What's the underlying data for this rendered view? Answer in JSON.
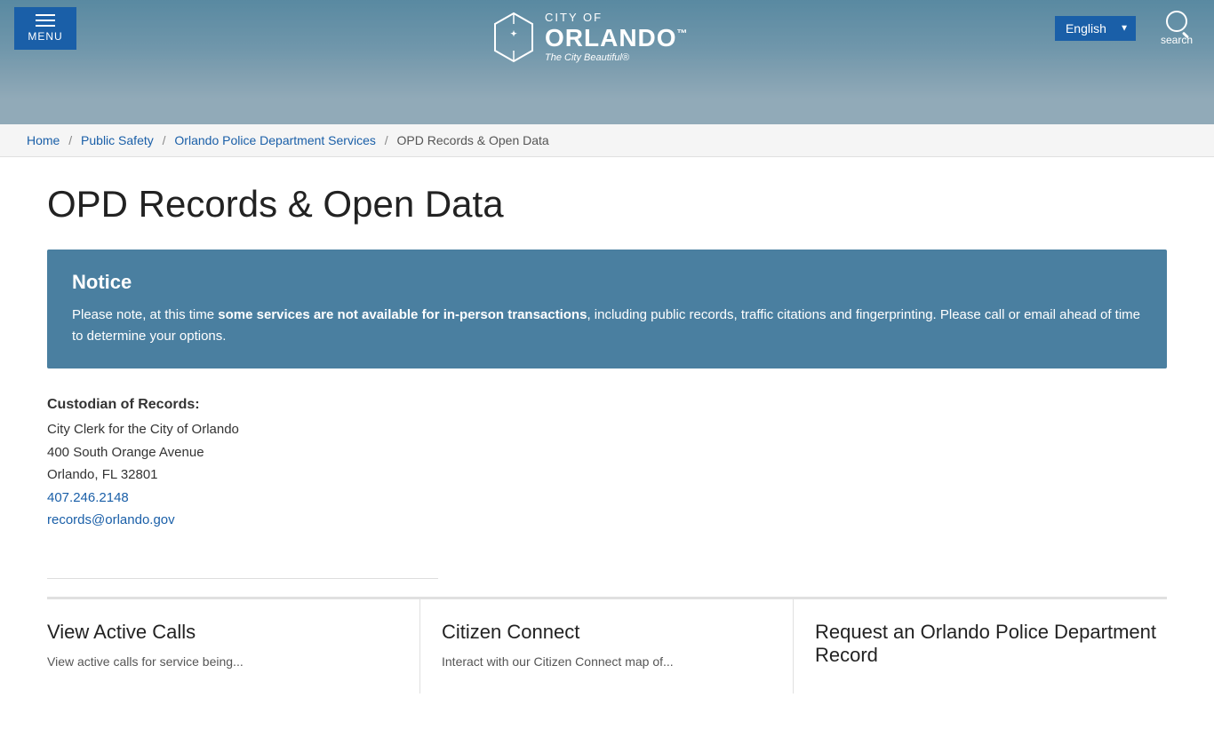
{
  "header": {
    "menu_label": "menu",
    "logo_city_of": "CITY OF",
    "logo_orlando": "ORLANDO",
    "logo_trademark": "™",
    "logo_tagline": "The City Beautiful®",
    "language_label": "English",
    "search_label": "search"
  },
  "breadcrumb": {
    "home": "Home",
    "public_safety": "Public Safety",
    "opd_services": "Orlando Police Department Services",
    "current": "OPD Records & Open Data"
  },
  "page": {
    "title": "OPD Records & Open Data"
  },
  "notice": {
    "title": "Notice",
    "text_before_bold": "Please note, at this time ",
    "bold_text": "some services are not available for in-person transactions",
    "text_after_bold": ", including public records, traffic citations and fingerprinting. Please call or email ahead of time to determine your options."
  },
  "custodian": {
    "section_title": "Custodian of Records:",
    "name": "City Clerk for the City of Orlando",
    "address1": "400 South Orange Avenue",
    "address2": "Orlando, FL 32801",
    "phone": "407.246.2148",
    "email": "records@orlando.gov"
  },
  "cards": [
    {
      "title": "View Active Calls",
      "desc": "View active calls for service being..."
    },
    {
      "title": "Citizen Connect",
      "desc": "Interact with our Citizen Connect map of..."
    },
    {
      "title": "Request an Orlando Police Department Record",
      "desc": ""
    }
  ]
}
